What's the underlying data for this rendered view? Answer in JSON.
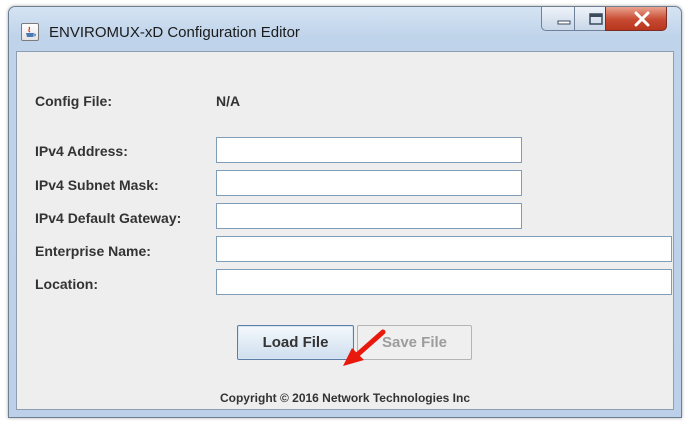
{
  "window": {
    "title": "ENVIROMUX-xD Configuration Editor",
    "controls": [
      "minimize",
      "maximize",
      "close"
    ]
  },
  "form": {
    "config_file_label": "Config File:",
    "config_file_value": "N/A",
    "fields": [
      {
        "label": "IPv4 Address:",
        "value": ""
      },
      {
        "label": "IPv4 Subnet Mask:",
        "value": ""
      },
      {
        "label": "IPv4 Default Gateway:",
        "value": ""
      },
      {
        "label": "Enterprise Name:",
        "value": ""
      },
      {
        "label": "Location:",
        "value": ""
      }
    ]
  },
  "buttons": {
    "load": "Load File",
    "save": "Save File"
  },
  "footer": {
    "copyright": "Copyright © 2016 Network Technologies Inc"
  },
  "annotation": {
    "icon": "red-arrow-icon",
    "color": "#e8180c"
  },
  "colors": {
    "titlebar": "#bfd3ea",
    "client_background": "#eeeeee",
    "close_button": "#c74a31"
  }
}
